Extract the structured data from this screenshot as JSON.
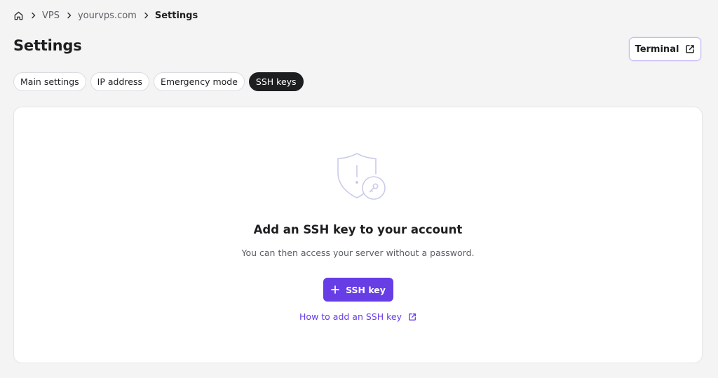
{
  "breadcrumb": {
    "home_icon": "home-icon",
    "items": [
      "VPS",
      "yourvps.com"
    ],
    "current": "Settings",
    "separator_icon": "chevron-right-icon"
  },
  "header": {
    "title": "Settings",
    "terminal_button": {
      "label": "Terminal",
      "icon": "external-link-icon"
    }
  },
  "tabs": [
    {
      "label": "Main settings",
      "active": false
    },
    {
      "label": "IP address",
      "active": false
    },
    {
      "label": "Emergency mode",
      "active": false
    },
    {
      "label": "SSH keys",
      "active": true
    }
  ],
  "empty_state": {
    "illustration_icon": "shield-key-icon",
    "title": "Add an SSH key to your account",
    "description": "You can then access your server without a password.",
    "primary_button": {
      "label": "SSH key",
      "icon": "plus-icon"
    },
    "help_link": {
      "label": "How to add an SSH key",
      "icon": "external-link-icon"
    }
  },
  "colors": {
    "accent": "#673de6",
    "background": "#f4f4f4",
    "card": "#ffffff",
    "active_tab": "#1d1e20",
    "illustration": "#c9ccea"
  }
}
